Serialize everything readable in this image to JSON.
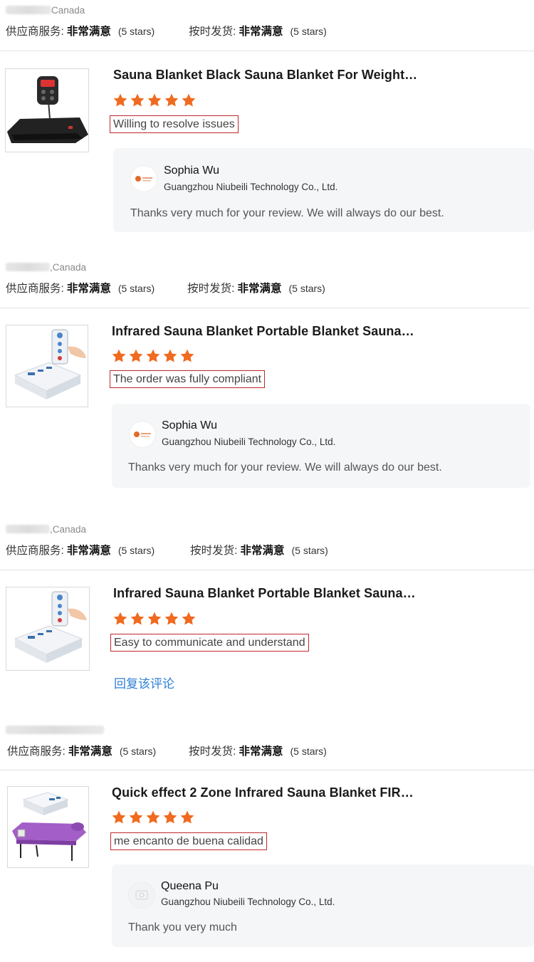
{
  "labels": {
    "supplier_service": "供应商服务:",
    "on_time_shipping": "按时发货:",
    "very_satisfied": "非常满意",
    "five_stars": "(5 stars)",
    "reply_link": "回复该评论"
  },
  "colors": {
    "star": "#f06a1f",
    "comment_border": "#c0282b",
    "link": "#2f7fd3",
    "reply_bg": "#f5f6f8"
  },
  "reviews": [
    {
      "country": "Canada",
      "product_title": "Sauna Blanket Black Sauna Blanket For Weight…",
      "stars": 5,
      "comment": "Willing to resolve issues",
      "reply": {
        "name": "Sophia Wu",
        "company": "Guangzhou Niubeili Technology Co., Ltd.",
        "text": "Thanks very much for your review. We will always do our best."
      }
    },
    {
      "country": ",Canada",
      "product_title": "Infrared Sauna Blanket Portable Blanket Sauna…",
      "stars": 5,
      "comment": "The order was fully compliant",
      "reply": {
        "name": "Sophia Wu",
        "company": "Guangzhou Niubeili Technology Co., Ltd.",
        "text": "Thanks very much for your review. We will always do our best."
      }
    },
    {
      "country": ",Canada",
      "product_title": "Infrared Sauna Blanket Portable Blanket Sauna…",
      "stars": 5,
      "comment": "Easy to communicate and understand"
    },
    {
      "country": "",
      "product_title": "Quick effect 2 Zone Infrared Sauna Blanket FIR…",
      "stars": 5,
      "comment": "me  encanto de buena calidad",
      "reply": {
        "name": "Queena Pu",
        "company": "Guangzhou Niubeili Technology Co., Ltd.",
        "text": "Thank you very much"
      }
    }
  ]
}
